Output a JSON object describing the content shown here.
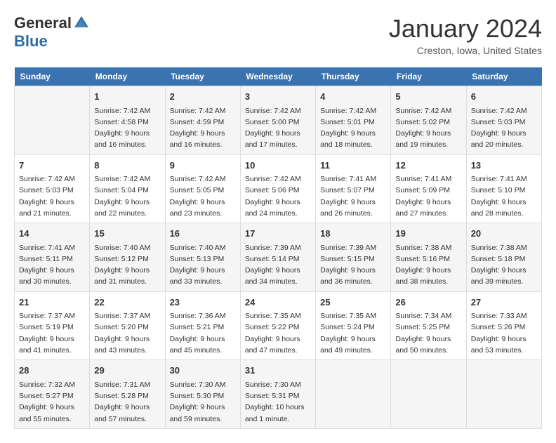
{
  "header": {
    "logo_general": "General",
    "logo_blue": "Blue",
    "title": "January 2024",
    "location": "Creston, Iowa, United States"
  },
  "calendar": {
    "days_header": [
      "Sunday",
      "Monday",
      "Tuesday",
      "Wednesday",
      "Thursday",
      "Friday",
      "Saturday"
    ],
    "weeks": [
      [
        {
          "day": "",
          "sunrise": "",
          "sunset": "",
          "daylight": ""
        },
        {
          "day": "1",
          "sunrise": "Sunrise: 7:42 AM",
          "sunset": "Sunset: 4:58 PM",
          "daylight": "Daylight: 9 hours and 16 minutes."
        },
        {
          "day": "2",
          "sunrise": "Sunrise: 7:42 AM",
          "sunset": "Sunset: 4:59 PM",
          "daylight": "Daylight: 9 hours and 16 minutes."
        },
        {
          "day": "3",
          "sunrise": "Sunrise: 7:42 AM",
          "sunset": "Sunset: 5:00 PM",
          "daylight": "Daylight: 9 hours and 17 minutes."
        },
        {
          "day": "4",
          "sunrise": "Sunrise: 7:42 AM",
          "sunset": "Sunset: 5:01 PM",
          "daylight": "Daylight: 9 hours and 18 minutes."
        },
        {
          "day": "5",
          "sunrise": "Sunrise: 7:42 AM",
          "sunset": "Sunset: 5:02 PM",
          "daylight": "Daylight: 9 hours and 19 minutes."
        },
        {
          "day": "6",
          "sunrise": "Sunrise: 7:42 AM",
          "sunset": "Sunset: 5:03 PM",
          "daylight": "Daylight: 9 hours and 20 minutes."
        }
      ],
      [
        {
          "day": "7",
          "sunrise": "Sunrise: 7:42 AM",
          "sunset": "Sunset: 5:03 PM",
          "daylight": "Daylight: 9 hours and 21 minutes."
        },
        {
          "day": "8",
          "sunrise": "Sunrise: 7:42 AM",
          "sunset": "Sunset: 5:04 PM",
          "daylight": "Daylight: 9 hours and 22 minutes."
        },
        {
          "day": "9",
          "sunrise": "Sunrise: 7:42 AM",
          "sunset": "Sunset: 5:05 PM",
          "daylight": "Daylight: 9 hours and 23 minutes."
        },
        {
          "day": "10",
          "sunrise": "Sunrise: 7:42 AM",
          "sunset": "Sunset: 5:06 PM",
          "daylight": "Daylight: 9 hours and 24 minutes."
        },
        {
          "day": "11",
          "sunrise": "Sunrise: 7:41 AM",
          "sunset": "Sunset: 5:07 PM",
          "daylight": "Daylight: 9 hours and 26 minutes."
        },
        {
          "day": "12",
          "sunrise": "Sunrise: 7:41 AM",
          "sunset": "Sunset: 5:09 PM",
          "daylight": "Daylight: 9 hours and 27 minutes."
        },
        {
          "day": "13",
          "sunrise": "Sunrise: 7:41 AM",
          "sunset": "Sunset: 5:10 PM",
          "daylight": "Daylight: 9 hours and 28 minutes."
        }
      ],
      [
        {
          "day": "14",
          "sunrise": "Sunrise: 7:41 AM",
          "sunset": "Sunset: 5:11 PM",
          "daylight": "Daylight: 9 hours and 30 minutes."
        },
        {
          "day": "15",
          "sunrise": "Sunrise: 7:40 AM",
          "sunset": "Sunset: 5:12 PM",
          "daylight": "Daylight: 9 hours and 31 minutes."
        },
        {
          "day": "16",
          "sunrise": "Sunrise: 7:40 AM",
          "sunset": "Sunset: 5:13 PM",
          "daylight": "Daylight: 9 hours and 33 minutes."
        },
        {
          "day": "17",
          "sunrise": "Sunrise: 7:39 AM",
          "sunset": "Sunset: 5:14 PM",
          "daylight": "Daylight: 9 hours and 34 minutes."
        },
        {
          "day": "18",
          "sunrise": "Sunrise: 7:39 AM",
          "sunset": "Sunset: 5:15 PM",
          "daylight": "Daylight: 9 hours and 36 minutes."
        },
        {
          "day": "19",
          "sunrise": "Sunrise: 7:38 AM",
          "sunset": "Sunset: 5:16 PM",
          "daylight": "Daylight: 9 hours and 38 minutes."
        },
        {
          "day": "20",
          "sunrise": "Sunrise: 7:38 AM",
          "sunset": "Sunset: 5:18 PM",
          "daylight": "Daylight: 9 hours and 39 minutes."
        }
      ],
      [
        {
          "day": "21",
          "sunrise": "Sunrise: 7:37 AM",
          "sunset": "Sunset: 5:19 PM",
          "daylight": "Daylight: 9 hours and 41 minutes."
        },
        {
          "day": "22",
          "sunrise": "Sunrise: 7:37 AM",
          "sunset": "Sunset: 5:20 PM",
          "daylight": "Daylight: 9 hours and 43 minutes."
        },
        {
          "day": "23",
          "sunrise": "Sunrise: 7:36 AM",
          "sunset": "Sunset: 5:21 PM",
          "daylight": "Daylight: 9 hours and 45 minutes."
        },
        {
          "day": "24",
          "sunrise": "Sunrise: 7:35 AM",
          "sunset": "Sunset: 5:22 PM",
          "daylight": "Daylight: 9 hours and 47 minutes."
        },
        {
          "day": "25",
          "sunrise": "Sunrise: 7:35 AM",
          "sunset": "Sunset: 5:24 PM",
          "daylight": "Daylight: 9 hours and 49 minutes."
        },
        {
          "day": "26",
          "sunrise": "Sunrise: 7:34 AM",
          "sunset": "Sunset: 5:25 PM",
          "daylight": "Daylight: 9 hours and 50 minutes."
        },
        {
          "day": "27",
          "sunrise": "Sunrise: 7:33 AM",
          "sunset": "Sunset: 5:26 PM",
          "daylight": "Daylight: 9 hours and 53 minutes."
        }
      ],
      [
        {
          "day": "28",
          "sunrise": "Sunrise: 7:32 AM",
          "sunset": "Sunset: 5:27 PM",
          "daylight": "Daylight: 9 hours and 55 minutes."
        },
        {
          "day": "29",
          "sunrise": "Sunrise: 7:31 AM",
          "sunset": "Sunset: 5:28 PM",
          "daylight": "Daylight: 9 hours and 57 minutes."
        },
        {
          "day": "30",
          "sunrise": "Sunrise: 7:30 AM",
          "sunset": "Sunset: 5:30 PM",
          "daylight": "Daylight: 9 hours and 59 minutes."
        },
        {
          "day": "31",
          "sunrise": "Sunrise: 7:30 AM",
          "sunset": "Sunset: 5:31 PM",
          "daylight": "Daylight: 10 hours and 1 minute."
        },
        {
          "day": "",
          "sunrise": "",
          "sunset": "",
          "daylight": ""
        },
        {
          "day": "",
          "sunrise": "",
          "sunset": "",
          "daylight": ""
        },
        {
          "day": "",
          "sunrise": "",
          "sunset": "",
          "daylight": ""
        }
      ]
    ]
  }
}
